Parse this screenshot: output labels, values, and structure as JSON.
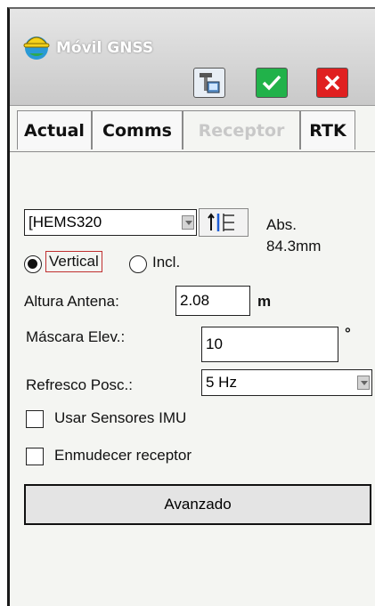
{
  "app": {
    "title": "Móvil GNSS"
  },
  "toolbar": {
    "device_icon": "receptor-device-icon",
    "ok_icon": "check-icon",
    "cancel_icon": "close-icon"
  },
  "tabs": [
    {
      "label": "Actual",
      "active": false
    },
    {
      "label": "Comms",
      "active": false
    },
    {
      "label": "Receptor",
      "active": true
    },
    {
      "label": "RTK",
      "active": false
    }
  ],
  "antenna": {
    "model": "[HEMS320",
    "abs_label": "Abs.",
    "abs_value": "84.3mm",
    "mode_vertical": "Vertical",
    "mode_incl": "Incl.",
    "selected_mode": "Vertical"
  },
  "height": {
    "label": "Altura Antena:",
    "value": "2.08",
    "unit": "m"
  },
  "mask": {
    "label": "Máscara Elev.:",
    "value": "10",
    "unit": "°"
  },
  "refresh": {
    "label": "Refresco Posc.:",
    "value": "5 Hz"
  },
  "options": {
    "imu_label": "Usar Sensores IMU",
    "imu_checked": false,
    "mute_label": "Enmudecer receptor",
    "mute_checked": false
  },
  "advanced_label": "Avanzado",
  "colors": {
    "ok": "#21b24a",
    "cancel": "#e02020",
    "active_tab_text": "#c8c8c8"
  }
}
